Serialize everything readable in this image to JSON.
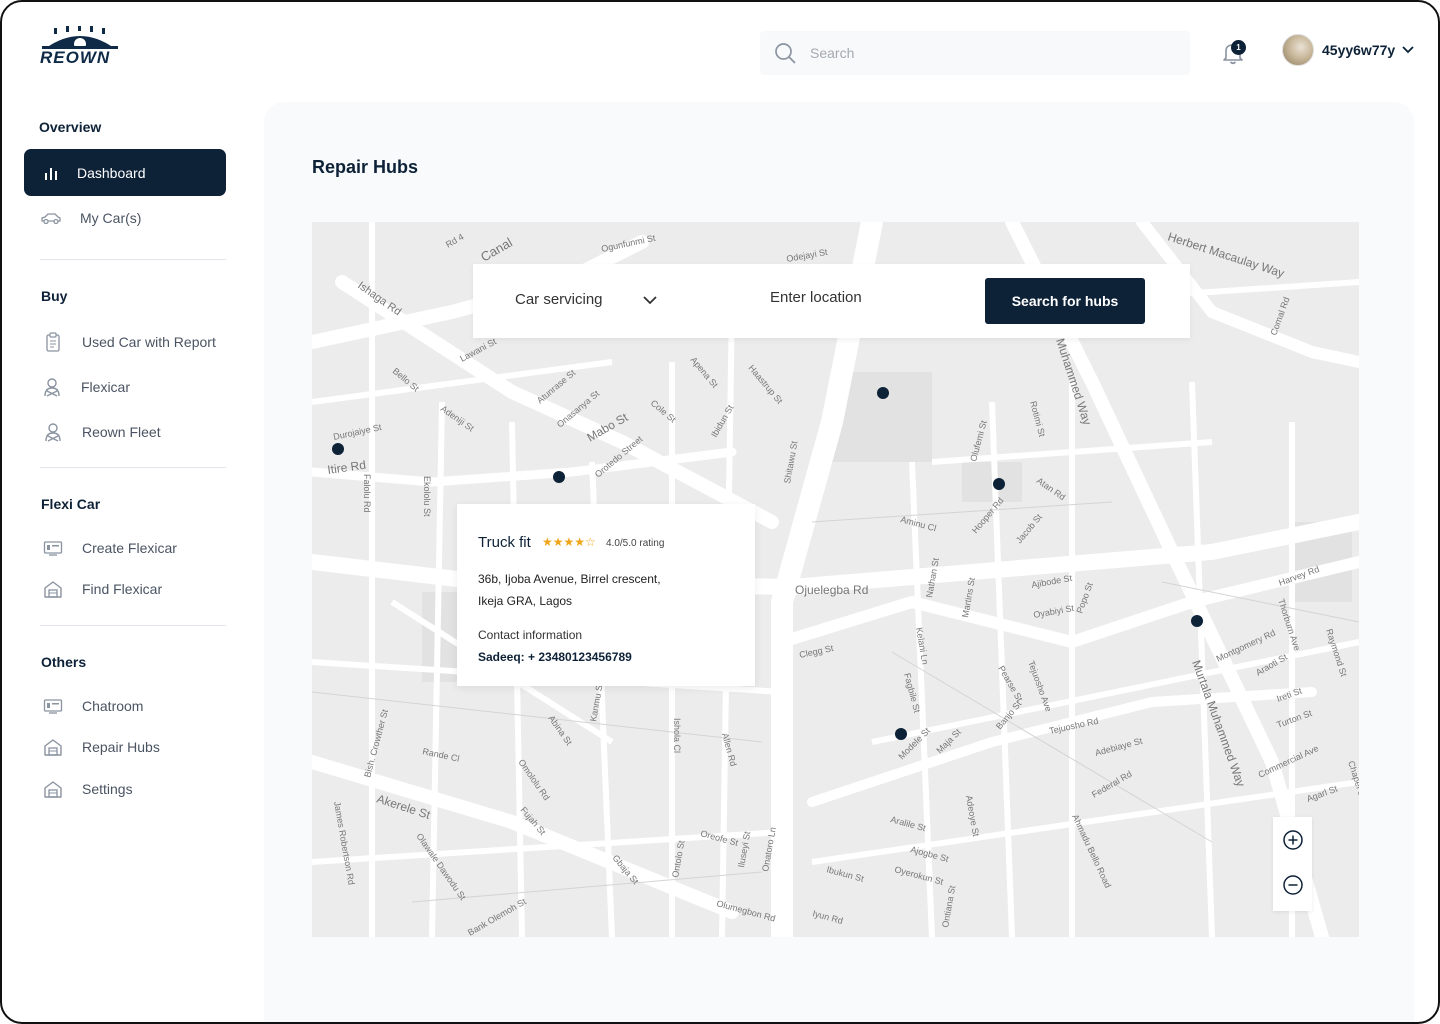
{
  "brand": {
    "name": "REOWN",
    "primary": "#0d2137",
    "accent": "#f0a419"
  },
  "header": {
    "search_placeholder": "Search",
    "notification_count": "1",
    "username": "45yy6w77y"
  },
  "sidebar": {
    "sections": [
      {
        "title": "Overview",
        "items": [
          {
            "label": "Dashboard",
            "icon": "bar-chart-icon",
            "active": true
          },
          {
            "label": "My Car(s)",
            "icon": "car-icon"
          }
        ]
      },
      {
        "title": "Buy",
        "items": [
          {
            "label": "Used Car with Report",
            "icon": "clipboard-icon"
          },
          {
            "label": "Flexicar",
            "icon": "driver-icon"
          },
          {
            "label": "Reown Fleet",
            "icon": "driver-icon"
          }
        ]
      },
      {
        "title": "Flexi Car",
        "items": [
          {
            "label": "Create Flexicar",
            "icon": "screen-icon"
          },
          {
            "label": "Find Flexicar",
            "icon": "garage-icon"
          }
        ]
      },
      {
        "title": "Others",
        "items": [
          {
            "label": "Chatroom",
            "icon": "screen-icon"
          },
          {
            "label": "Repair Hubs",
            "icon": "garage-icon"
          },
          {
            "label": "Settings",
            "icon": "garage-icon"
          }
        ]
      }
    ]
  },
  "main": {
    "title": "Repair Hubs",
    "filters": {
      "service": "Car servicing",
      "location_placeholder": "Enter location",
      "search_button": "Search for hubs"
    },
    "hub_card": {
      "name": "Truck fit",
      "stars": "★★★★☆",
      "rating": "4.0/5.0 rating",
      "address_line1": "36b, Ijoba Avenue, Birrel crescent,",
      "address_line2": "Ikeja GRA, Lagos",
      "contact_label": "Contact information",
      "contact_value": "Sadeeq: + 23480123456789"
    },
    "map": {
      "street_labels": [
        "Herbert Macaulay Way",
        "Ishaga Rd",
        "Ogunfunmi St",
        "Lawani St",
        "Canal",
        "Rd 4",
        "Odejayi St",
        "Durojaiye St",
        "Itire Rd",
        "Bello St",
        "Adeniji St",
        "Atunrase St",
        "Onasanya St",
        "Mabo St",
        "Cole St",
        "Apena St",
        "Haastrup St",
        "Ibidun St",
        "Orotedo Street",
        "Shitawu St",
        "Falolu Rd",
        "Ekololu St",
        "Ojuelegba Rd",
        "Aminu Cl",
        "Nathan St",
        "Martins St",
        "Olufemi St",
        "Rotimi St",
        "Hooper Rd",
        "Jacob St",
        "Atan Rd",
        "Ajibode St",
        "Oyabiyi St",
        "Popo St",
        "Muhammed Way",
        "Murtala Muhammed Way",
        "Harvey Rd",
        "Montgomery Rd",
        "Thorburn Ave",
        "Raymond St",
        "Araoti St",
        "Ireti St",
        "Turton St",
        "Commercial Ave",
        "Agarl St",
        "Chapel St",
        "Clegg St",
        "Kelani Ln",
        "Fagbile St",
        "Modele St",
        "Maja St",
        "Banjo St",
        "Pearse St",
        "Tejuosho Ave",
        "Tejuosho Rd",
        "Adebiaye St",
        "Federal Rd",
        "Adeoye St",
        "Ahmadu Bello Road",
        "Aralile St",
        "Ajogbe St",
        "Oyerokun St",
        "Ibukun St",
        "Ontiana St",
        "Iyun Rd",
        "Olumegbon Rd",
        "Oreofe St",
        "Iluseyi St",
        "Onatoro Ln",
        "Ontolo St",
        "Gbaja St",
        "Akerele St",
        "Bank Olemoh St",
        "Olawale Dawodu St",
        "James Robertson Rd",
        "Bish. Crowther St",
        "Rande Cl",
        "Abina St",
        "Omololu Rd",
        "Fujah St",
        "Allen Rd",
        "Ishola Cl",
        "Kanmu St",
        "Comal Rd"
      ]
    },
    "zoom": {
      "in_icon": "plus-circle-icon",
      "out_icon": "minus-circle-icon"
    }
  }
}
